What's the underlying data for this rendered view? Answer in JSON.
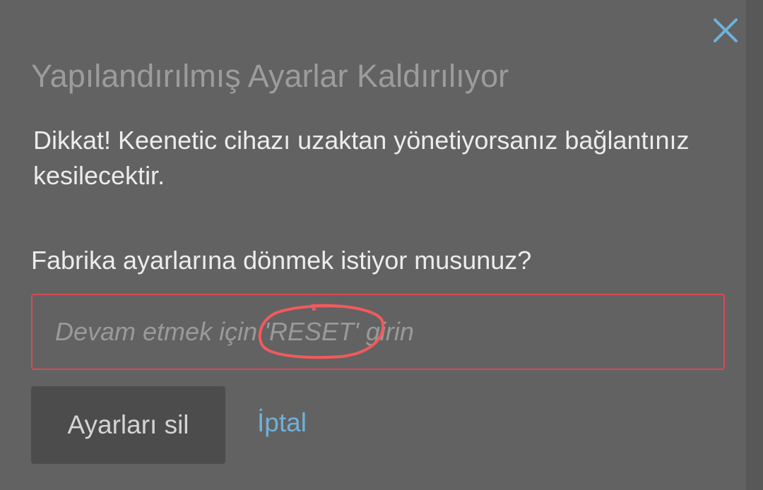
{
  "dialog": {
    "title": "Yapılandırılmış Ayarlar Kaldırılıyor",
    "warning": "Dikkat! Keenetic cihazı uzaktan yönetiyorsanız bağlantınız kesilecektir.",
    "question": "Fabrika ayarlarına dönmek istiyor musunuz?",
    "input": {
      "value": "",
      "placeholder": "Devam etmek için 'RESET' girin"
    },
    "delete_label": "Ayarları sil",
    "cancel_label": "İptal",
    "close_icon": "close-icon"
  },
  "colors": {
    "overlay": "#585858",
    "dialog_bg": "#626262",
    "title_text": "#9c9c9c",
    "body_text": "#ececec",
    "input_border": "#d54a55",
    "placeholder_text": "#9a9a9a",
    "button_bg": "#4c4c4c",
    "button_text": "#d4d4d4",
    "link": "#6fb1d8",
    "close_icon": "#6fb1d8",
    "annotation": "#f25a5c"
  }
}
